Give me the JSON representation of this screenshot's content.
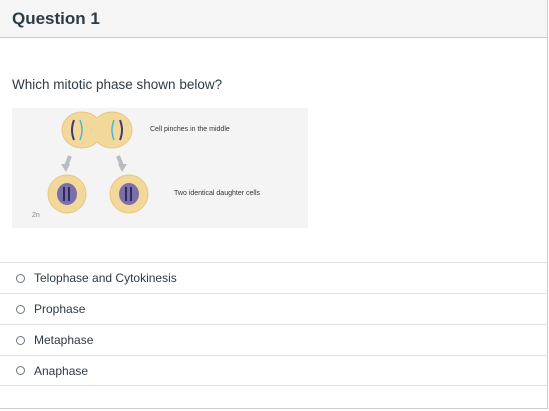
{
  "question": {
    "title": "Question 1",
    "text": "Which mitotic phase shown below?"
  },
  "figure": {
    "label_top": "Cell pinches in the middle",
    "label_bottom": "Two identical daughter cells",
    "label_ploidy": "2n",
    "colors": {
      "cell_fill": "#f2d89b",
      "cell_edge": "#e8c77e",
      "nucleus": "#7a6fa8",
      "nucleus_dark": "#3f3a78",
      "spindle": "#4bb8c9",
      "arrow": "#b9bcc0"
    }
  },
  "answers": [
    {
      "label": "Telophase and Cytokinesis"
    },
    {
      "label": "Prophase"
    },
    {
      "label": "Metaphase"
    },
    {
      "label": "Anaphase"
    }
  ]
}
